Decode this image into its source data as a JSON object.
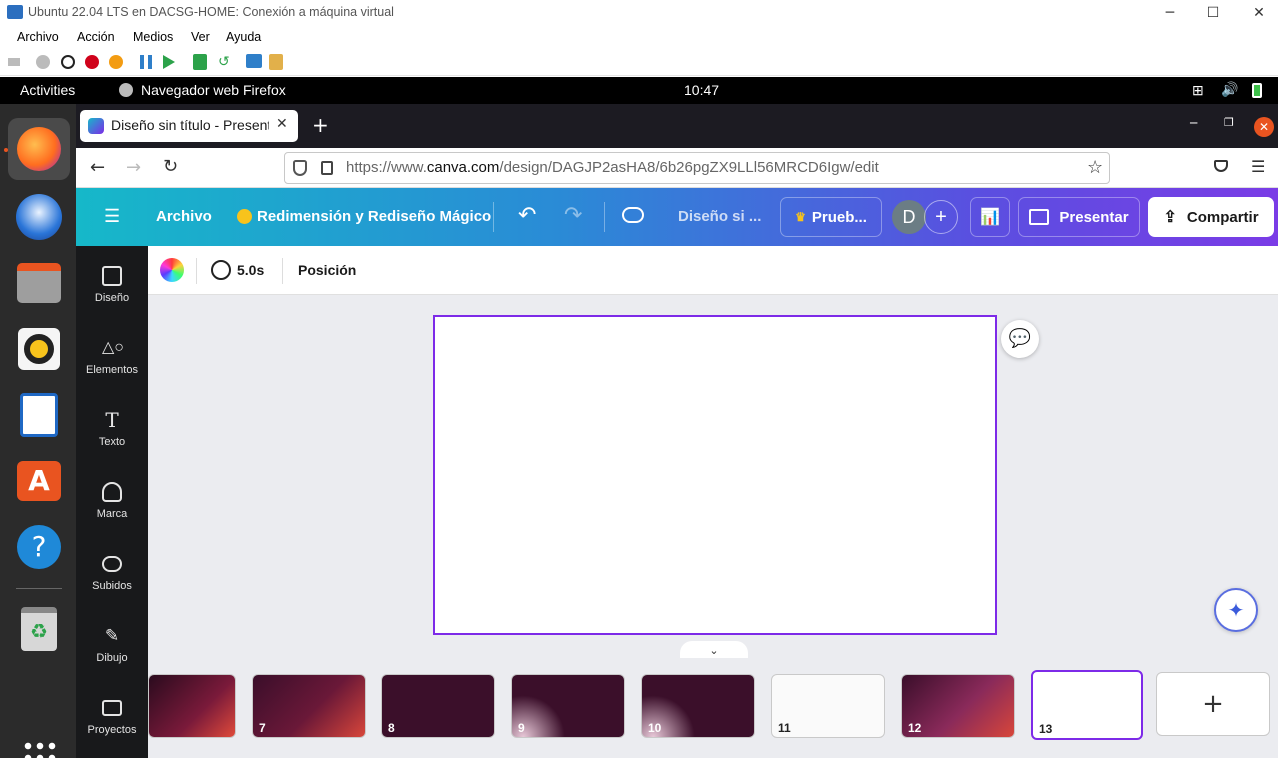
{
  "vm_window": {
    "title": "Ubuntu 22.04 LTS en DACSG-HOME: Conexión a máquina virtual",
    "menu": [
      "Archivo",
      "Acción",
      "Medios",
      "Ver",
      "Ayuda"
    ]
  },
  "gnome": {
    "activities": "Activities",
    "app_name": "Navegador web Firefox",
    "clock": "10:47"
  },
  "firefox": {
    "tab_title": "Diseño sin título - Presentación",
    "url_prefix": "https://www.",
    "url_domain": "canva.com",
    "url_path": "/design/DAGJP2asHA8/6b26pgZX9LLl56MRCD6Igw/edit"
  },
  "canva": {
    "header": {
      "file_menu": "Archivo",
      "magic_resize": "Redimensión y Rediseño Mágico",
      "design_title": "Diseño si ...",
      "trial": "Prueb...",
      "avatar_letter": "D",
      "present": "Presentar",
      "share": "Compartir"
    },
    "sidebar": [
      {
        "label": "Diseño"
      },
      {
        "label": "Elementos"
      },
      {
        "label": "Texto"
      },
      {
        "label": "Marca"
      },
      {
        "label": "Subidos"
      },
      {
        "label": "Dibujo"
      },
      {
        "label": "Proyectos"
      }
    ],
    "toolbar": {
      "duration": "5.0s",
      "position": "Posición"
    },
    "pages": [
      {
        "num": "",
        "theme": "dark-red"
      },
      {
        "num": "7",
        "theme": "dark-red"
      },
      {
        "num": "8",
        "theme": "dark"
      },
      {
        "num": "9",
        "theme": "dark"
      },
      {
        "num": "10",
        "theme": "dark"
      },
      {
        "num": "11",
        "theme": "light"
      },
      {
        "num": "12",
        "theme": "red"
      },
      {
        "num": "13",
        "theme": "blank"
      }
    ],
    "selected_page": "13"
  },
  "colors": {
    "canva_purple": "#7d2ae8",
    "ubuntu_dock": "#2b2b2b",
    "firefox_tabbar": "#1c1b22"
  }
}
